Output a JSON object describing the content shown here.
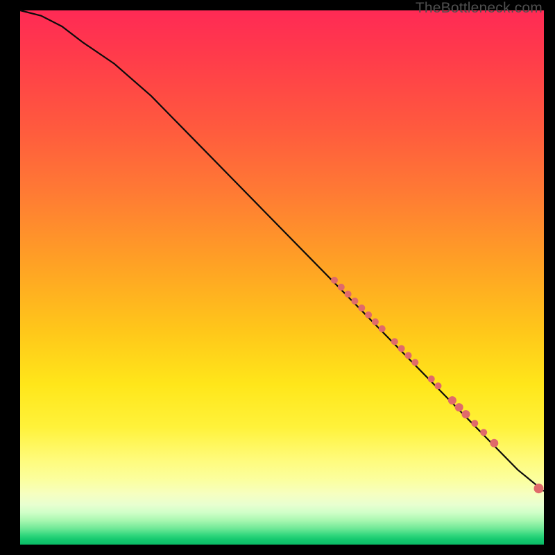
{
  "watermark": "TheBottleneck.com",
  "chart_data": {
    "type": "line",
    "title": "",
    "xlabel": "",
    "ylabel": "",
    "xlim": [
      0,
      100
    ],
    "ylim": [
      0,
      100
    ],
    "background_gradient": {
      "direction": "top-to-bottom",
      "stops": [
        {
          "pos": 0,
          "color": "#ff2a55",
          "meaning": "severe-bottleneck"
        },
        {
          "pos": 50,
          "color": "#ffc71a",
          "meaning": "moderate"
        },
        {
          "pos": 90,
          "color": "#f6ffc0",
          "meaning": "near-balanced"
        },
        {
          "pos": 100,
          "color": "#0abc66",
          "meaning": "balanced"
        }
      ]
    },
    "series": [
      {
        "name": "bottleneck-curve",
        "kind": "line",
        "x": [
          0,
          4,
          8,
          12,
          18,
          25,
          35,
          45,
          55,
          65,
          75,
          85,
          95,
          100
        ],
        "y": [
          100,
          99,
          97,
          94,
          90,
          84,
          74,
          64,
          54,
          44,
          34,
          24,
          14,
          10
        ]
      },
      {
        "name": "sample-points",
        "kind": "scatter",
        "points": [
          {
            "x": 60.0,
            "y": 49.5,
            "r": 5
          },
          {
            "x": 61.3,
            "y": 48.2,
            "r": 5
          },
          {
            "x": 62.6,
            "y": 46.9,
            "r": 5
          },
          {
            "x": 63.9,
            "y": 45.6,
            "r": 5
          },
          {
            "x": 65.2,
            "y": 44.3,
            "r": 5
          },
          {
            "x": 66.5,
            "y": 43.0,
            "r": 5
          },
          {
            "x": 67.8,
            "y": 41.7,
            "r": 5
          },
          {
            "x": 69.1,
            "y": 40.4,
            "r": 5
          },
          {
            "x": 71.5,
            "y": 38.0,
            "r": 5
          },
          {
            "x": 72.8,
            "y": 36.7,
            "r": 5
          },
          {
            "x": 74.1,
            "y": 35.4,
            "r": 5
          },
          {
            "x": 75.4,
            "y": 34.1,
            "r": 5
          },
          {
            "x": 78.5,
            "y": 31.0,
            "r": 5
          },
          {
            "x": 79.8,
            "y": 29.7,
            "r": 5
          },
          {
            "x": 82.5,
            "y": 27.0,
            "r": 6
          },
          {
            "x": 83.8,
            "y": 25.7,
            "r": 6
          },
          {
            "x": 85.1,
            "y": 24.4,
            "r": 6
          },
          {
            "x": 86.8,
            "y": 22.7,
            "r": 5
          },
          {
            "x": 88.5,
            "y": 21.0,
            "r": 5
          },
          {
            "x": 90.5,
            "y": 19.0,
            "r": 6
          },
          {
            "x": 99.0,
            "y": 10.5,
            "r": 7
          }
        ]
      }
    ]
  }
}
